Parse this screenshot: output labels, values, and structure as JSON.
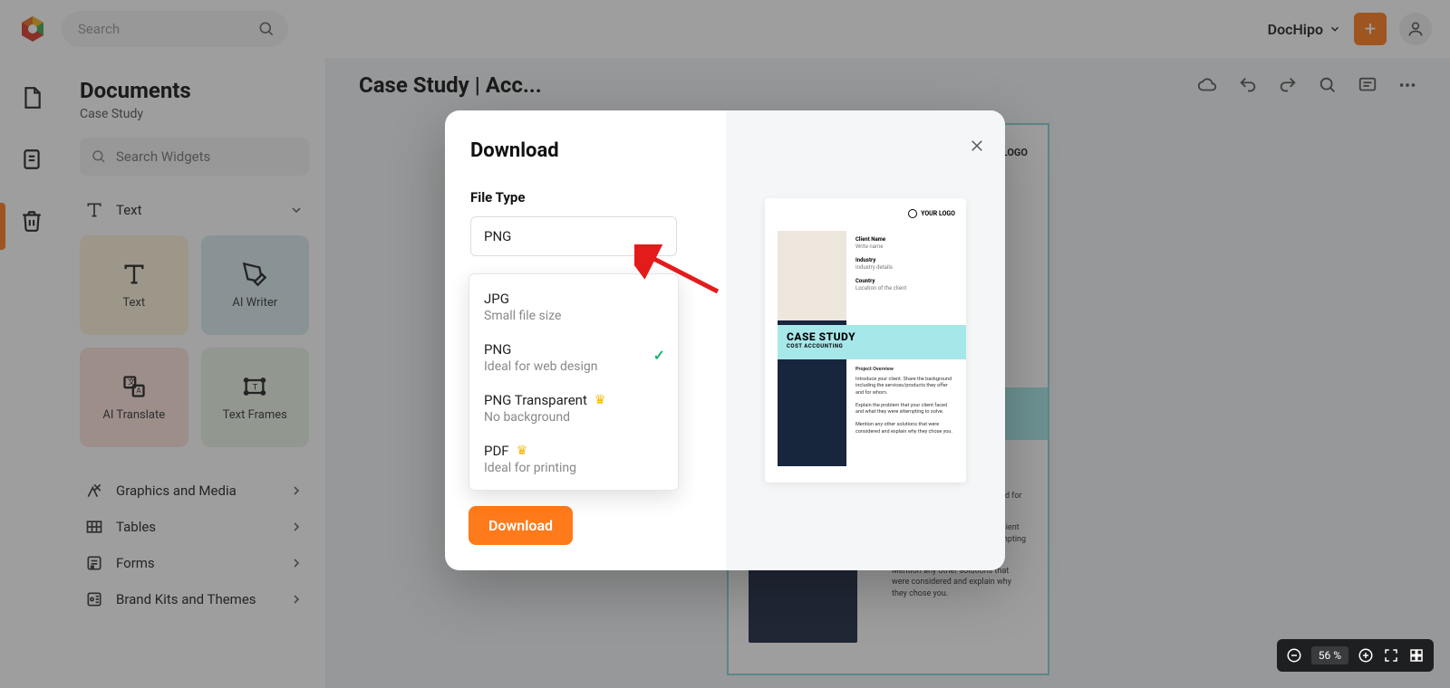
{
  "topbar": {
    "search_placeholder": "Search",
    "account_label": "DocHipo"
  },
  "sidepanel": {
    "title": "Documents",
    "subtitle": "Case Study",
    "search_placeholder": "Search Widgets",
    "text_section": "Text",
    "widgets": [
      {
        "label": "Text"
      },
      {
        "label": "AI Writer"
      },
      {
        "label": "AI Translate"
      },
      {
        "label": "Text Frames"
      }
    ],
    "sections": [
      "Graphics and Media",
      "Tables",
      "Forms",
      "Brand Kits and Themes"
    ]
  },
  "canvas": {
    "doc_title": "Case Study | Acc..."
  },
  "modal": {
    "title": "Download",
    "file_type_label": "File Type",
    "selected": "PNG",
    "options": [
      {
        "name": "JPG",
        "desc": "Small file size",
        "premium": false,
        "selected": false
      },
      {
        "name": "PNG",
        "desc": "Ideal for web design",
        "premium": false,
        "selected": true
      },
      {
        "name": "PNG Transparent",
        "desc": "No background",
        "premium": true,
        "selected": false
      },
      {
        "name": "PDF",
        "desc": "Ideal for printing",
        "premium": true,
        "selected": false
      }
    ],
    "download_btn": "Download"
  },
  "preview": {
    "logo_text": "YOUR LOGO",
    "client_name_label": "Client Name",
    "client_name_hint": "Write name",
    "industry_label": "Industry",
    "industry_hint": "Industry details",
    "country_label": "Country",
    "country_hint": "Location of the client",
    "banner_title": "CASE STUDY",
    "banner_sub": "COST ACCOUNTING",
    "overview_label": "Project Overview",
    "p1": "Introduce your client. Share the background including the services/products they offer and for whom.",
    "p2": "Explain the problem that your client faced and what they were attempting to solve.",
    "p3": "Mention any other solutions that were considered and explain why they chose you."
  },
  "zoom": {
    "value": "56 %"
  }
}
